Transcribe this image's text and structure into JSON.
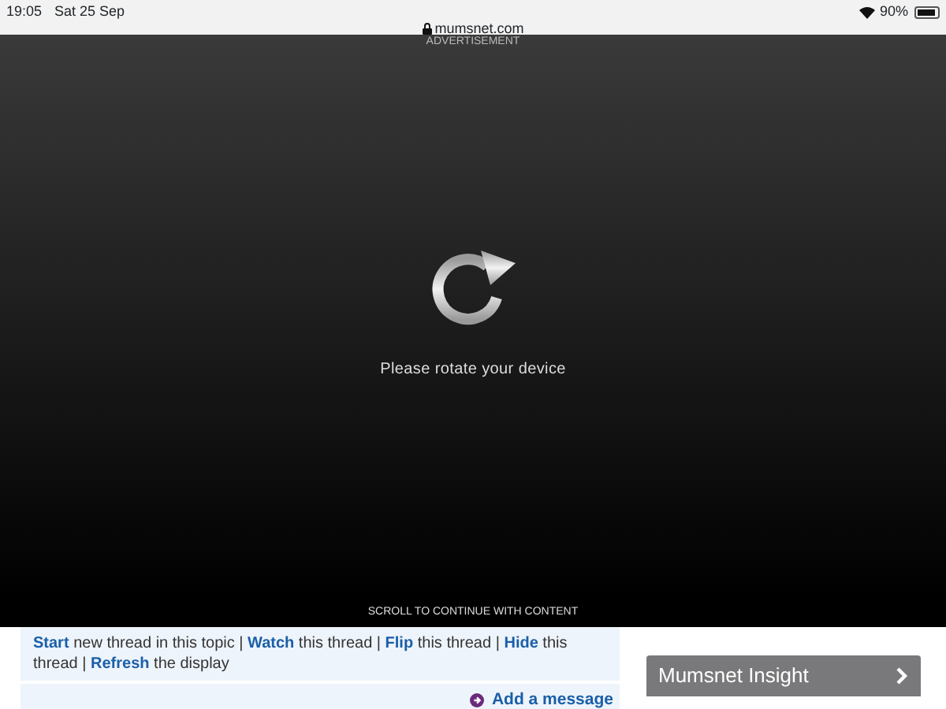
{
  "status_bar": {
    "time": "19:05",
    "date": "Sat 25 Sep",
    "url": "mumsnet.com",
    "battery": "90%"
  },
  "advert": {
    "label": "ADVERTISEMENT",
    "message": "Please rotate your device",
    "footer": "SCROLL TO CONTINUE WITH CONTENT"
  },
  "thread_actions": {
    "separator": "|",
    "items": [
      {
        "link": "Start",
        "rest": "new thread in this topic"
      },
      {
        "link": "Watch",
        "rest": "this thread"
      },
      {
        "link": "Flip",
        "rest": "this thread"
      },
      {
        "link": "Hide",
        "rest": "this thread"
      },
      {
        "link": "Refresh",
        "rest": "the display"
      }
    ]
  },
  "add_message": "Add a message",
  "sidebar_button": "Mumsnet Insight"
}
